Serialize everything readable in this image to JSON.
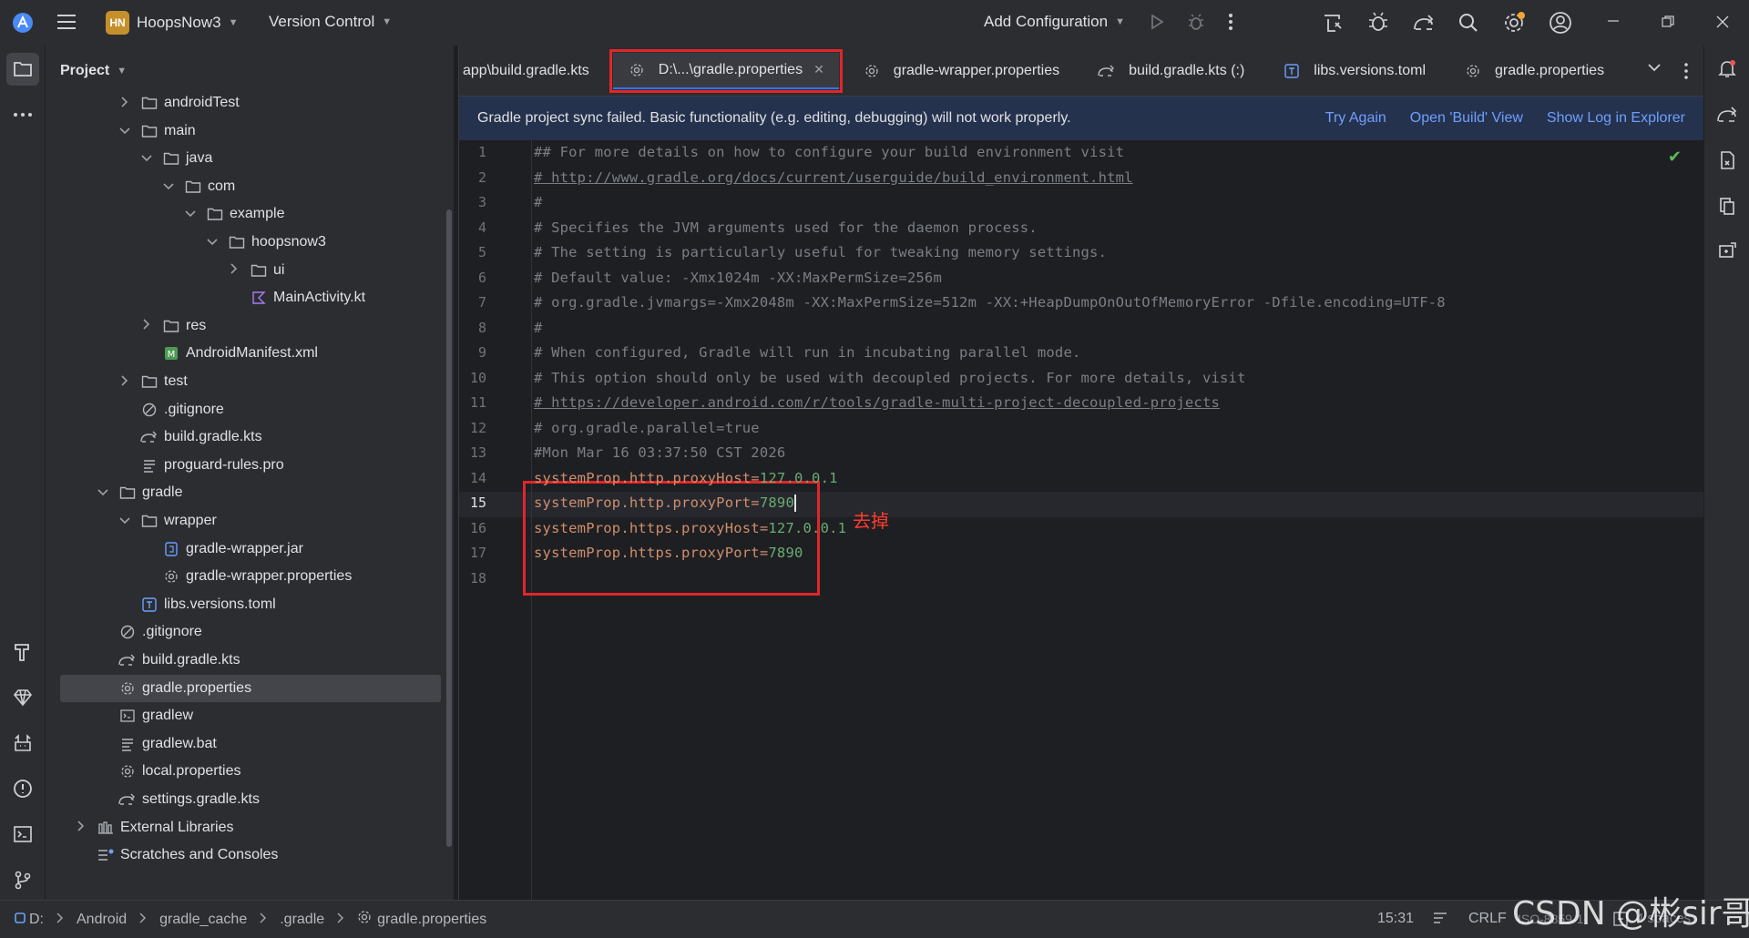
{
  "titlebar": {
    "project_badge": "HN",
    "project_name": "HoopsNow3",
    "vcs": "Version Control",
    "run_config": "Add Configuration"
  },
  "project_panel": {
    "title": "Project",
    "tree": [
      {
        "label": "androidTest",
        "icon": "folder-icon",
        "indent": 3,
        "chevron": "right"
      },
      {
        "label": "main",
        "icon": "folder-icon",
        "indent": 3,
        "chevron": "down"
      },
      {
        "label": "java",
        "icon": "folder-icon",
        "indent": 4,
        "chevron": "down"
      },
      {
        "label": "com",
        "icon": "folder-icon",
        "indent": 5,
        "chevron": "down"
      },
      {
        "label": "example",
        "icon": "folder-icon",
        "indent": 6,
        "chevron": "down"
      },
      {
        "label": "hoopsnow3",
        "icon": "folder-icon",
        "indent": 7,
        "chevron": "down"
      },
      {
        "label": "ui",
        "icon": "folder-icon",
        "indent": 8,
        "chevron": "right"
      },
      {
        "label": "MainActivity.kt",
        "icon": "kotlin-icon",
        "indent": 8,
        "chevron": "none"
      },
      {
        "label": "res",
        "icon": "folder-icon",
        "indent": 4,
        "chevron": "right"
      },
      {
        "label": "AndroidManifest.xml",
        "icon": "manifest-icon",
        "indent": 4,
        "chevron": "none"
      },
      {
        "label": "test",
        "icon": "folder-icon",
        "indent": 3,
        "chevron": "right"
      },
      {
        "label": ".gitignore",
        "icon": "ignore-icon",
        "indent": 3,
        "chevron": "none"
      },
      {
        "label": "build.gradle.kts",
        "icon": "gradle-icon",
        "indent": 3,
        "chevron": "none"
      },
      {
        "label": "proguard-rules.pro",
        "icon": "text-file-icon",
        "indent": 3,
        "chevron": "none"
      },
      {
        "label": "gradle",
        "icon": "folder-icon",
        "indent": 2,
        "chevron": "down"
      },
      {
        "label": "wrapper",
        "icon": "folder-icon",
        "indent": 3,
        "chevron": "down"
      },
      {
        "label": "gradle-wrapper.jar",
        "icon": "jar-icon",
        "indent": 4,
        "chevron": "none"
      },
      {
        "label": "gradle-wrapper.properties",
        "icon": "gear-icon",
        "indent": 4,
        "chevron": "none"
      },
      {
        "label": "libs.versions.toml",
        "icon": "toml-icon",
        "indent": 3,
        "chevron": "none"
      },
      {
        "label": ".gitignore",
        "icon": "ignore-icon",
        "indent": 2,
        "chevron": "none"
      },
      {
        "label": "build.gradle.kts",
        "icon": "gradle-icon",
        "indent": 2,
        "chevron": "none"
      },
      {
        "label": "gradle.properties",
        "icon": "gear-icon",
        "indent": 2,
        "chevron": "none",
        "selected": true
      },
      {
        "label": "gradlew",
        "icon": "terminal-icon",
        "indent": 2,
        "chevron": "none"
      },
      {
        "label": "gradlew.bat",
        "icon": "text-file-icon",
        "indent": 2,
        "chevron": "none"
      },
      {
        "label": "local.properties",
        "icon": "gear-icon",
        "indent": 2,
        "chevron": "none"
      },
      {
        "label": "settings.gradle.kts",
        "icon": "gradle-icon",
        "indent": 2,
        "chevron": "none"
      },
      {
        "label": "External Libraries",
        "icon": "library-icon",
        "indent": 1,
        "chevron": "right"
      },
      {
        "label": "Scratches and Consoles",
        "icon": "scratch-icon",
        "indent": 1,
        "chevron": "none"
      }
    ]
  },
  "tabs": [
    {
      "label": "app\\build.gradle.kts",
      "icon": "",
      "active": false
    },
    {
      "label": "D:\\...\\gradle.properties",
      "icon": "gear-icon",
      "active": true,
      "closable": true
    },
    {
      "label": "gradle-wrapper.properties",
      "icon": "gear-icon",
      "active": false
    },
    {
      "label": "build.gradle.kts (:)",
      "icon": "gradle-icon",
      "active": false
    },
    {
      "label": "libs.versions.toml",
      "icon": "toml-icon",
      "active": false
    },
    {
      "label": "gradle.properties",
      "icon": "gear-icon",
      "active": false
    }
  ],
  "notice": {
    "message": "Gradle project sync failed. Basic functionality (e.g. editing, debugging) will not work properly.",
    "try_again": "Try Again",
    "open_build": "Open 'Build' View",
    "show_log": "Show Log in Explorer"
  },
  "editor": {
    "current_line": 15,
    "lines": [
      {
        "n": "1",
        "text": "## For more details on how to configure your build environment visit",
        "kind": "comment"
      },
      {
        "n": "2",
        "text": "# http://www.gradle.org/docs/current/userguide/build_environment.html",
        "kind": "url"
      },
      {
        "n": "3",
        "text": "#",
        "kind": "comment"
      },
      {
        "n": "4",
        "text": "# Specifies the JVM arguments used for the daemon process.",
        "kind": "comment"
      },
      {
        "n": "5",
        "text": "# The setting is particularly useful for tweaking memory settings.",
        "kind": "comment"
      },
      {
        "n": "6",
        "text": "# Default value: -Xmx1024m -XX:MaxPermSize=256m",
        "kind": "comment"
      },
      {
        "n": "7",
        "text": "# org.gradle.jvmargs=-Xmx2048m -XX:MaxPermSize=512m -XX:+HeapDumpOnOutOfMemoryError -Dfile.encoding=UTF-8",
        "kind": "comment"
      },
      {
        "n": "8",
        "text": "#",
        "kind": "comment"
      },
      {
        "n": "9",
        "text": "# When configured, Gradle will run in incubating parallel mode.",
        "kind": "comment"
      },
      {
        "n": "10",
        "text": "# This option should only be used with decoupled projects. For more details, visit",
        "kind": "comment"
      },
      {
        "n": "11",
        "text": "# https://developer.android.com/r/tools/gradle-multi-project-decoupled-projects",
        "kind": "url"
      },
      {
        "n": "12",
        "text": "# org.gradle.parallel=true",
        "kind": "comment"
      },
      {
        "n": "13",
        "text": "#Mon Mar 16 03:37:50 CST 2026",
        "kind": "comment"
      },
      {
        "n": "14",
        "key": "systemProp.http.proxyHost",
        "value": "127.0.0.1",
        "kind": "prop"
      },
      {
        "n": "15",
        "key": "systemProp.http.proxyPort",
        "value": "7890",
        "kind": "prop"
      },
      {
        "n": "16",
        "key": "systemProp.https.proxyHost",
        "value": "127.0.0.1",
        "kind": "prop"
      },
      {
        "n": "17",
        "key": "systemProp.https.proxyPort",
        "value": "7890",
        "kind": "prop"
      },
      {
        "n": "18",
        "text": "",
        "kind": "comment"
      }
    ],
    "annotation": "去掉",
    "annotation_color": "#e0262a"
  },
  "statusbar": {
    "breadcrumbs": [
      "D:",
      "Android",
      "gradle_cache",
      ".gradle",
      "gradle.properties"
    ],
    "position": "15:31",
    "line_sep": "CRLF",
    "encoding": "ISO-8859-1",
    "indent": "4 spaces"
  },
  "watermark": "CSDN @彬sir哥",
  "colors": {
    "accent": "#3574f0",
    "link": "#6e9fff",
    "annotation": "#e0262a",
    "property_key": "#cf8e6d",
    "property_value": "#6aab73"
  }
}
